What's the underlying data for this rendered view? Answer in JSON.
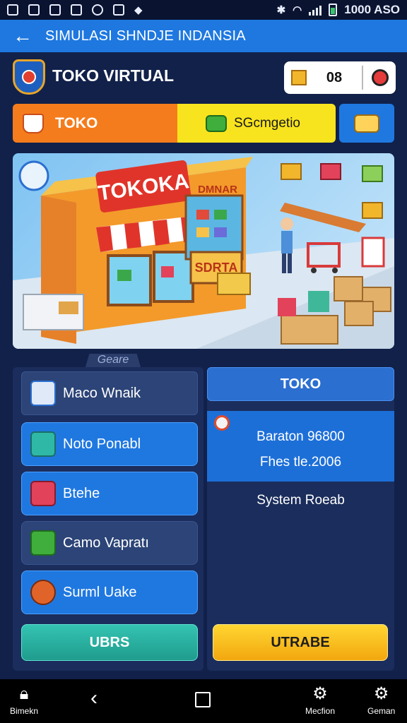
{
  "status_bar": {
    "left_icons": [
      "image-icon",
      "image-icon",
      "image-icon",
      "card-icon",
      "clock-icon",
      "edit-icon",
      "location-icon"
    ],
    "right_text": "1000 ASO"
  },
  "app_bar": {
    "title": "SIMULASI SHNDJE INDANSIA"
  },
  "header": {
    "store_title": "TOKO VIRTUAL",
    "widget_text": "08"
  },
  "tabs": {
    "toko_label": "TOKO",
    "yellow_label": "SGcmgetio"
  },
  "hero": {
    "sign_text": "TOKOKA",
    "shop_sign_1": "DMNAR",
    "shop_sign_2": "SDRTA",
    "caption_below": "Geare"
  },
  "left_panel": {
    "items": [
      {
        "label": "Maco Wnaik"
      },
      {
        "label": "Noto Ponabl"
      },
      {
        "label": "Btehe"
      },
      {
        "label": "Camo Vapratı"
      },
      {
        "label": "Surml Uake"
      }
    ],
    "button_label": "UBRS"
  },
  "right_panel": {
    "header_label": "TOKO",
    "line1": "Baraton 96800",
    "line2": "Fhes tle.2006",
    "system_text": "System Roeab",
    "button_label": "UTRABE"
  },
  "nav_bar": {
    "left_label": "Bimekn",
    "right1_label": "Mecfion",
    "right2_label": "Geman"
  },
  "colors": {
    "accent_blue": "#1f78e0",
    "orange": "#f57c1c",
    "yellow": "#f8e41e",
    "teal": "#2fb8a6"
  }
}
